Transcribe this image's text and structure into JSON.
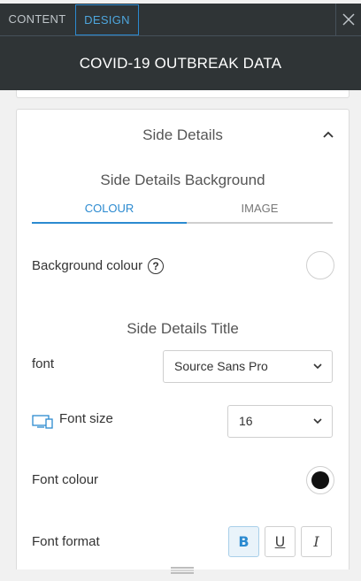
{
  "tabs": {
    "content": "CONTENT",
    "design": "DESIGN",
    "active": "DESIGN"
  },
  "header": {
    "title": "COVID-19 OUTBREAK DATA"
  },
  "section": {
    "title": "Side Details",
    "expanded": true
  },
  "background": {
    "title": "Side Details Background",
    "tab_colour": "COLOUR",
    "tab_image": "IMAGE",
    "active_tab": "COLOUR",
    "colour_label": "Background colour",
    "help_glyph": "?",
    "colour_value": "#ffffff"
  },
  "title_settings": {
    "heading": "Side Details Title",
    "font_label": "font",
    "font_value": "Source Sans Pro",
    "font_size_label": "Font size",
    "font_size_value": "16",
    "font_colour_label": "Font colour",
    "font_colour_value": "#111111",
    "font_format_label": "Font format",
    "format_bold": "B",
    "format_underline": "U",
    "format_italic": "I"
  },
  "colors": {
    "accent": "#2b8ad0",
    "header_bg": "#2f3436"
  },
  "icons": {
    "close": "close-icon",
    "chevron_up": "chevron-up-icon",
    "chevron_down": "chevron-down-icon",
    "device": "responsive-devices-icon",
    "help": "help-icon",
    "resize": "resize-handle-icon"
  }
}
